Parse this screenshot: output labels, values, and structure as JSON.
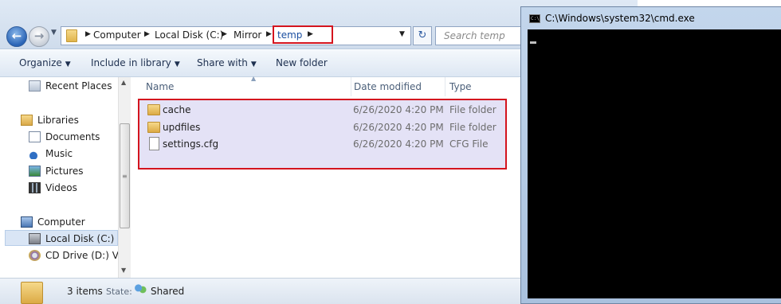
{
  "explorer": {
    "address": {
      "crumbs": [
        "Computer",
        "Local Disk (C:)",
        "Mirror",
        "temp"
      ],
      "search_placeholder": "Search temp"
    },
    "toolbar": {
      "organize": "Organize",
      "include_in_library": "Include in library",
      "share_with": "Share with",
      "new_folder": "New folder"
    },
    "nav": {
      "recent_places": "Recent Places",
      "libraries": "Libraries",
      "documents": "Documents",
      "music": "Music",
      "pictures": "Pictures",
      "videos": "Videos",
      "computer": "Computer",
      "local_disk": "Local Disk (C:)",
      "cd_drive": "CD Drive (D:) Virt"
    },
    "columns": {
      "name": "Name",
      "date_modified": "Date modified",
      "type": "Type"
    },
    "files": [
      {
        "name": "cache",
        "date": "6/26/2020 4:20 PM",
        "type": "File folder"
      },
      {
        "name": "updfiles",
        "date": "6/26/2020 4:20 PM",
        "type": "File folder"
      },
      {
        "name": "settings.cfg",
        "date": "6/26/2020 4:20 PM",
        "type": "CFG File"
      }
    ],
    "status": {
      "count": "3 items",
      "state_label": "State:",
      "state_value": "Shared"
    }
  },
  "cmd": {
    "title": "C:\\Windows\\system32\\cmd.exe"
  },
  "colors": {
    "highlight_border": "#d4141e",
    "selection_fill": "#e4e2f6",
    "console_bg": "#000000"
  }
}
